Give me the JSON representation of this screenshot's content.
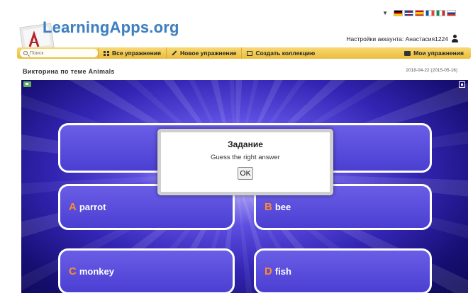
{
  "header": {
    "logo_text": "LearningApps.org",
    "account_text": "Настройки аккаунта: Анастасия1224"
  },
  "nav": {
    "search_placeholder": "Поиск",
    "items": [
      {
        "label": "Все упражнения",
        "icon": "grid-icon"
      },
      {
        "label": "Новое упражнение",
        "icon": "pencil-icon"
      },
      {
        "label": "Создать коллекцию",
        "icon": "collection-icon"
      }
    ],
    "my_exercises": "Мои упражнения"
  },
  "page": {
    "title": "Викторина по теме Animals",
    "dates": "2018-04-22 (2015-05-16)"
  },
  "quiz": {
    "answers": [
      {
        "letter": "A",
        "text": "parrot"
      },
      {
        "letter": "B",
        "text": "bee"
      },
      {
        "letter": "C",
        "text": "monkey"
      },
      {
        "letter": "D",
        "text": "fish"
      }
    ]
  },
  "modal": {
    "title": "Задание",
    "text": "Guess the right answer",
    "ok_label": "OK"
  },
  "colors": {
    "nav_bar": "#eabd3b",
    "answer_letter": "#ff8c2a",
    "logo_blue": "#3f7fbf"
  }
}
